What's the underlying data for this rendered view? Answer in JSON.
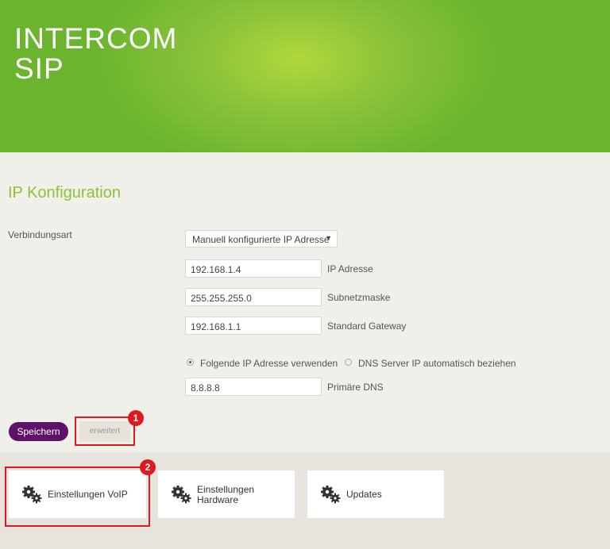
{
  "header": {
    "brand_line1": "INTERCOM",
    "brand_line2": "SIP"
  },
  "page_title": "IP Konfiguration",
  "form": {
    "connection_label": "Verbindungsart",
    "connection_value": "Manuell konfigurierte IP Adresse",
    "ip_value": "192.168.1.4",
    "ip_label": "IP Adresse",
    "subnet_value": "255.255.255.0",
    "subnet_label": "Subnetzmaske",
    "gateway_value": "192.168.1.1",
    "gateway_label": "Standard Gateway",
    "radio_manual_label": "Folgende IP Adresse verwenden",
    "radio_auto_label": "DNS Server IP automatisch beziehen",
    "dns_value": "8.8.8.8",
    "dns_label": "Primäre DNS"
  },
  "buttons": {
    "save": "Speichern",
    "advanced": "erweitert"
  },
  "annotations": {
    "badge1": "1",
    "badge2": "2"
  },
  "tiles": [
    {
      "label": "Einstellungen VoIP",
      "icon": "gears-icon"
    },
    {
      "label_line1": "Einstellungen",
      "label_line2": "Hardware",
      "icon": "gears-icon"
    },
    {
      "label": "Updates",
      "icon": "gears-icon"
    }
  ],
  "colors": {
    "accent_green": "#8cc33a",
    "save_button": "#5e1168",
    "highlight_red": "#e0191e"
  }
}
